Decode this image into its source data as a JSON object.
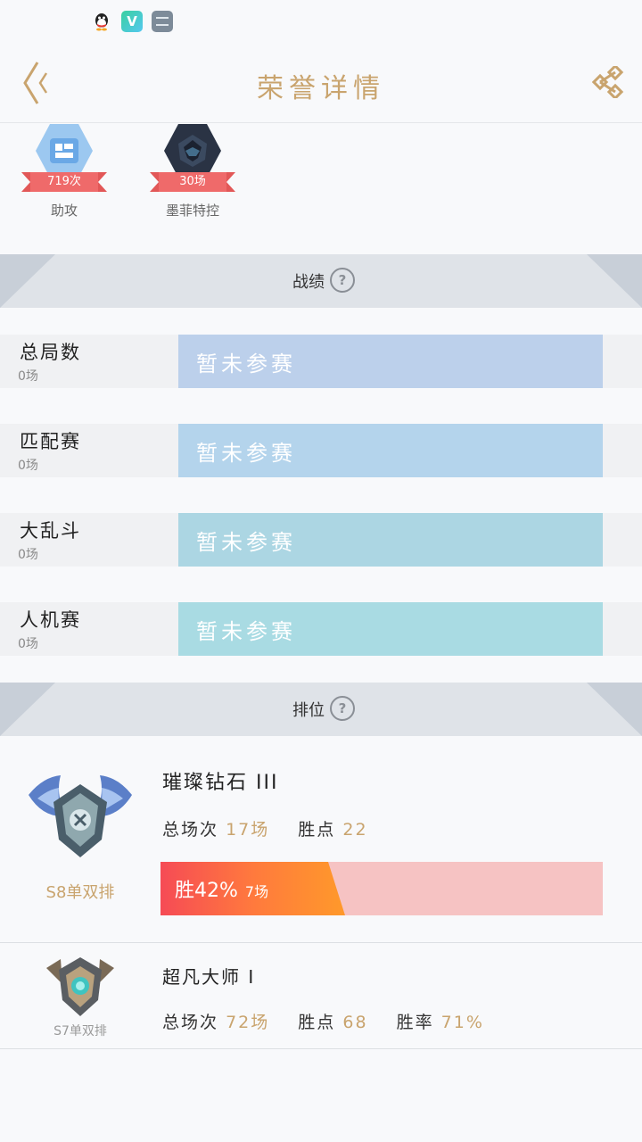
{
  "status": {
    "icons": [
      "qq-icon",
      "vv-app-icon",
      "message-icon"
    ]
  },
  "header": {
    "title": "荣誉详情"
  },
  "badges": [
    {
      "count": "719次",
      "label": "助攻"
    },
    {
      "count": "30场",
      "label": "墨菲特控"
    }
  ],
  "sections": {
    "record": "战绩",
    "rank": "排位",
    "help_symbol": "?"
  },
  "records": [
    {
      "label": "总局数",
      "games": "0场",
      "status": "暂未参赛",
      "color": "#bcd0eb"
    },
    {
      "label": "匹配赛",
      "games": "0场",
      "status": "暂未参赛",
      "color": "#b4d4ec"
    },
    {
      "label": "大乱斗",
      "games": "0场",
      "status": "暂未参赛",
      "color": "#acd6e3"
    },
    {
      "label": "人机赛",
      "games": "0场",
      "status": "暂未参赛",
      "color": "#a9dbe3"
    }
  ],
  "ranks": [
    {
      "season": "S8单双排",
      "tier": "璀璨钻石 III",
      "total_label": "总场次",
      "total_value": "17场",
      "points_label": "胜点",
      "points_value": "22",
      "win_label": "胜42%",
      "win_count": "7场",
      "win_rate": 0.42
    },
    {
      "season": "S7单双排",
      "tier": "超凡大师 I",
      "total_label": "总场次",
      "total_value": "72场",
      "points_label": "胜点",
      "points_value": "68",
      "rate_label": "胜率",
      "rate_value": "71%"
    }
  ]
}
